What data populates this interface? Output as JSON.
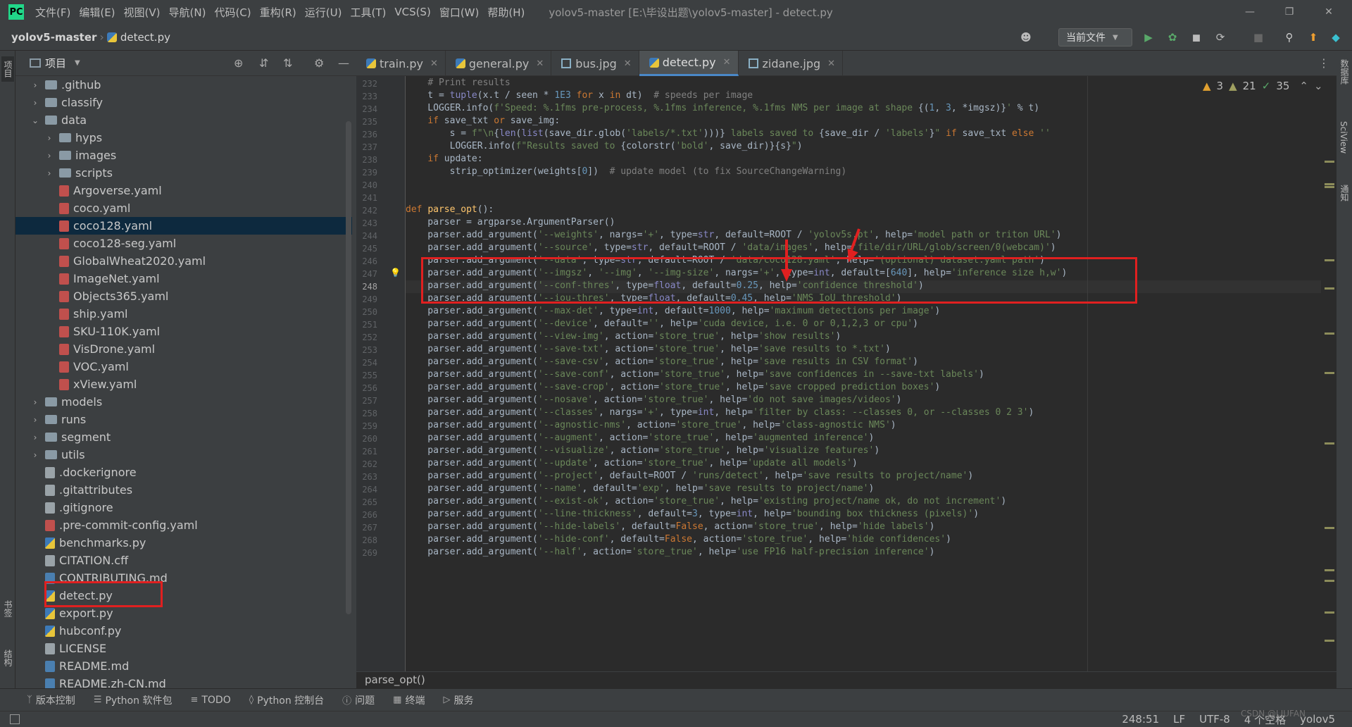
{
  "menubar": {
    "logo": "PC",
    "items": [
      "文件(F)",
      "编辑(E)",
      "视图(V)",
      "导航(N)",
      "代码(C)",
      "重构(R)",
      "运行(U)",
      "工具(T)",
      "VCS(S)",
      "窗口(W)",
      "帮助(H)"
    ],
    "window_title": "yolov5-master [E:\\毕设出题\\yolov5-master] - detect.py"
  },
  "toolbar": {
    "project_name": "yolov5-master",
    "file_name": "detect.py",
    "run_config": "当前文件"
  },
  "left_stripe": {
    "project": "项目",
    "bookmarks": "书签",
    "structure": "结构"
  },
  "project_panel": {
    "title": "项目",
    "tree": [
      {
        "label": ".github",
        "type": "folder",
        "depth": 0,
        "expanded": false
      },
      {
        "label": "classify",
        "type": "folder",
        "depth": 0,
        "expanded": false
      },
      {
        "label": "data",
        "type": "folder",
        "depth": 0,
        "expanded": true
      },
      {
        "label": "hyps",
        "type": "folder",
        "depth": 1,
        "expanded": false
      },
      {
        "label": "images",
        "type": "folder",
        "depth": 1,
        "expanded": false
      },
      {
        "label": "scripts",
        "type": "folder",
        "depth": 1,
        "expanded": false
      },
      {
        "label": "Argoverse.yaml",
        "type": "yaml",
        "depth": 1
      },
      {
        "label": "coco.yaml",
        "type": "yaml",
        "depth": 1
      },
      {
        "label": "coco128.yaml",
        "type": "yaml",
        "depth": 1,
        "selected": true
      },
      {
        "label": "coco128-seg.yaml",
        "type": "yaml",
        "depth": 1
      },
      {
        "label": "GlobalWheat2020.yaml",
        "type": "yaml",
        "depth": 1
      },
      {
        "label": "ImageNet.yaml",
        "type": "yaml",
        "depth": 1
      },
      {
        "label": "Objects365.yaml",
        "type": "yaml",
        "depth": 1
      },
      {
        "label": "ship.yaml",
        "type": "yaml",
        "depth": 1
      },
      {
        "label": "SKU-110K.yaml",
        "type": "yaml",
        "depth": 1
      },
      {
        "label": "VisDrone.yaml",
        "type": "yaml",
        "depth": 1
      },
      {
        "label": "VOC.yaml",
        "type": "yaml",
        "depth": 1
      },
      {
        "label": "xView.yaml",
        "type": "yaml",
        "depth": 1
      },
      {
        "label": "models",
        "type": "folder",
        "depth": 0,
        "expanded": false
      },
      {
        "label": "runs",
        "type": "folder",
        "depth": 0,
        "expanded": false
      },
      {
        "label": "segment",
        "type": "folder",
        "depth": 0,
        "expanded": false
      },
      {
        "label": "utils",
        "type": "folder",
        "depth": 0,
        "expanded": false
      },
      {
        "label": ".dockerignore",
        "type": "txt",
        "depth": 0
      },
      {
        "label": ".gitattributes",
        "type": "txt",
        "depth": 0
      },
      {
        "label": ".gitignore",
        "type": "txt",
        "depth": 0
      },
      {
        "label": ".pre-commit-config.yaml",
        "type": "yaml",
        "depth": 0
      },
      {
        "label": "benchmarks.py",
        "type": "py",
        "depth": 0
      },
      {
        "label": "CITATION.cff",
        "type": "txt",
        "depth": 0
      },
      {
        "label": "CONTRIBUTING.md",
        "type": "md",
        "depth": 0
      },
      {
        "label": "detect.py",
        "type": "py",
        "depth": 0
      },
      {
        "label": "export.py",
        "type": "py",
        "depth": 0
      },
      {
        "label": "hubconf.py",
        "type": "py",
        "depth": 0
      },
      {
        "label": "LICENSE",
        "type": "txt",
        "depth": 0
      },
      {
        "label": "README.md",
        "type": "md",
        "depth": 0
      },
      {
        "label": "README.zh-CN.md",
        "type": "md",
        "depth": 0
      }
    ]
  },
  "tabs": [
    {
      "label": "train.py",
      "icon": "py",
      "active": false
    },
    {
      "label": "general.py",
      "icon": "py",
      "active": false
    },
    {
      "label": "bus.jpg",
      "icon": "image",
      "active": false
    },
    {
      "label": "detect.py",
      "icon": "py",
      "active": true
    },
    {
      "label": "zidane.jpg",
      "icon": "image",
      "active": false
    }
  ],
  "inspections": {
    "warnings": "3",
    "weak_warnings": "21",
    "ok": "35"
  },
  "editor": {
    "current_line": 248,
    "lines": [
      {
        "n": 232,
        "h": "    <span class=\"cmt\"># Print results</span>"
      },
      {
        "n": 233,
        "h": "    t = <span class=\"bi\">tuple</span>(x.t / seen * <span class=\"num\">1E3</span> <span class=\"kw\">for</span> x <span class=\"kw\">in</span> dt)  <span class=\"cmt\"># speeds per image</span>"
      },
      {
        "n": 234,
        "h": "    LOGGER.info(<span class=\"str\">f'Speed: %.1fms pre-process, %.1fms inference, %.1fms NMS per image at shape </span>{(<span class=\"num\">1</span>, <span class=\"num\">3</span>, *imgsz)}<span class=\"str\">'</span> % t)"
      },
      {
        "n": 235,
        "h": "    <span class=\"kw\">if</span> save_txt <span class=\"kw\">or</span> save_img:"
      },
      {
        "n": 236,
        "h": "        s = <span class=\"str\">f\"\\n</span>{<span class=\"bi\">len</span>(<span class=\"bi\">list</span>(save_dir.glob(<span class=\"str\">'labels/*.txt'</span>)))}<span class=\"str\"> labels saved to </span>{save_dir / <span class=\"str\">'labels'</span>}<span class=\"str\">\"</span> <span class=\"kw\">if</span> save_txt <span class=\"kw\">else</span> <span class=\"str\">''</span>"
      },
      {
        "n": 237,
        "h": "        LOGGER.info(<span class=\"str\">f\"Results saved to </span>{colorstr(<span class=\"str\">'bold'</span>, save_dir)}{s}<span class=\"str\">\"</span>)"
      },
      {
        "n": 238,
        "h": "    <span class=\"kw\">if</span> update:"
      },
      {
        "n": 239,
        "h": "        strip_optimizer(weights[<span class=\"num\">0</span>])  <span class=\"cmt\"># update model (to fix SourceChangeWarning)</span>"
      },
      {
        "n": 240,
        "h": ""
      },
      {
        "n": 241,
        "h": ""
      },
      {
        "n": 242,
        "h": "<span class=\"kw\">def</span> <span class=\"fn\">parse_opt</span>():"
      },
      {
        "n": 243,
        "h": "    parser = argparse.ArgumentParser()"
      },
      {
        "n": 244,
        "h": "    parser.add_argument(<span class=\"str\">'--weights'</span>, nargs=<span class=\"str\">'+'</span>, type=<span class=\"bi\">str</span>, default=ROOT / <span class=\"str\">'yolov5s.pt'</span>, help=<span class=\"str\">'model path or triton URL'</span>)"
      },
      {
        "n": 245,
        "h": "    parser.add_argument(<span class=\"str\">'--source'</span>, type=<span class=\"bi\">str</span>, default=ROOT / <span class=\"str\">'data/images'</span>, help=<span class=\"str\">'file/dir/URL/glob/screen/0(webcam)'</span>)"
      },
      {
        "n": 246,
        "h": "    parser.add_argument(<span class=\"str\">'--data'</span>, type=<span class=\"bi\">str</span>, default=ROOT / <span class=\"str\">'data/coco128.yaml'</span>, help=<span class=\"str\">'(optional) dataset.yaml path'</span>)"
      },
      {
        "n": 247,
        "h": "    parser.add_argument(<span class=\"str\">'--imgsz'</span>, <span class=\"str\">'--img'</span>, <span class=\"str\">'--img-size'</span>, nargs=<span class=\"str\">'+'</span>, type=<span class=\"bi\">int</span>, default=[<span class=\"num\">640</span>], help=<span class=\"str\">'inference size h,w'</span>)"
      },
      {
        "n": 248,
        "h": "    parser.add_argument(<span class=\"str\">'--conf-thres'</span>, type=<span class=\"bi\">float</span>, default=<span class=\"num\">0.25</span>, help=<span class=\"str\">'confidence threshold'</span>)"
      },
      {
        "n": 249,
        "h": "    parser.add_argument(<span class=\"str\">'--iou-thres'</span>, type=<span class=\"bi\">float</span>, default=<span class=\"num\">0.45</span>, help=<span class=\"str\">'NMS IoU threshold'</span>)"
      },
      {
        "n": 250,
        "h": "    parser.add_argument(<span class=\"str\">'--max-det'</span>, type=<span class=\"bi\">int</span>, default=<span class=\"num\">1000</span>, help=<span class=\"str\">'maximum detections per image'</span>)"
      },
      {
        "n": 251,
        "h": "    parser.add_argument(<span class=\"str\">'--device'</span>, default=<span class=\"str\">''</span>, help=<span class=\"str\">'cuda device, i.e. 0 or 0,1,2,3 or cpu'</span>)"
      },
      {
        "n": 252,
        "h": "    parser.add_argument(<span class=\"str\">'--view-img'</span>, action=<span class=\"str\">'store_true'</span>, help=<span class=\"str\">'show results'</span>)"
      },
      {
        "n": 253,
        "h": "    parser.add_argument(<span class=\"str\">'--save-txt'</span>, action=<span class=\"str\">'store_true'</span>, help=<span class=\"str\">'save results to *.txt'</span>)"
      },
      {
        "n": 254,
        "h": "    parser.add_argument(<span class=\"str\">'--save-csv'</span>, action=<span class=\"str\">'store_true'</span>, help=<span class=\"str\">'save results in CSV format'</span>)"
      },
      {
        "n": 255,
        "h": "    parser.add_argument(<span class=\"str\">'--save-conf'</span>, action=<span class=\"str\">'store_true'</span>, help=<span class=\"str\">'save confidences in --save-txt labels'</span>)"
      },
      {
        "n": 256,
        "h": "    parser.add_argument(<span class=\"str\">'--save-crop'</span>, action=<span class=\"str\">'store_true'</span>, help=<span class=\"str\">'save cropped prediction boxes'</span>)"
      },
      {
        "n": 257,
        "h": "    parser.add_argument(<span class=\"str\">'--nosave'</span>, action=<span class=\"str\">'store_true'</span>, help=<span class=\"str\">'do not save images/videos'</span>)"
      },
      {
        "n": 258,
        "h": "    parser.add_argument(<span class=\"str\">'--classes'</span>, nargs=<span class=\"str\">'+'</span>, type=<span class=\"bi\">int</span>, help=<span class=\"str\">'filter by class: --classes 0, or --classes 0 2 3'</span>)"
      },
      {
        "n": 259,
        "h": "    parser.add_argument(<span class=\"str\">'--agnostic-nms'</span>, action=<span class=\"str\">'store_true'</span>, help=<span class=\"str\">'class-agnostic NMS'</span>)"
      },
      {
        "n": 260,
        "h": "    parser.add_argument(<span class=\"str\">'--augment'</span>, action=<span class=\"str\">'store_true'</span>, help=<span class=\"str\">'augmented inference'</span>)"
      },
      {
        "n": 261,
        "h": "    parser.add_argument(<span class=\"str\">'--visualize'</span>, action=<span class=\"str\">'store_true'</span>, help=<span class=\"str\">'visualize features'</span>)"
      },
      {
        "n": 262,
        "h": "    parser.add_argument(<span class=\"str\">'--update'</span>, action=<span class=\"str\">'store_true'</span>, help=<span class=\"str\">'update all models'</span>)"
      },
      {
        "n": 263,
        "h": "    parser.add_argument(<span class=\"str\">'--project'</span>, default=ROOT / <span class=\"str\">'runs/detect'</span>, help=<span class=\"str\">'save results to project/name'</span>)"
      },
      {
        "n": 264,
        "h": "    parser.add_argument(<span class=\"str\">'--name'</span>, default=<span class=\"str\">'exp'</span>, help=<span class=\"str\">'save results to project/name'</span>)"
      },
      {
        "n": 265,
        "h": "    parser.add_argument(<span class=\"str\">'--exist-ok'</span>, action=<span class=\"str\">'store_true'</span>, help=<span class=\"str\">'existing project/name ok, do not increment'</span>)"
      },
      {
        "n": 266,
        "h": "    parser.add_argument(<span class=\"str\">'--line-thickness'</span>, default=<span class=\"num\">3</span>, type=<span class=\"bi\">int</span>, help=<span class=\"str\">'bounding box thickness (pixels)'</span>)"
      },
      {
        "n": 267,
        "h": "    parser.add_argument(<span class=\"str\">'--hide-labels'</span>, default=<span class=\"kw\">False</span>, action=<span class=\"str\">'store_true'</span>, help=<span class=\"str\">'hide labels'</span>)"
      },
      {
        "n": 268,
        "h": "    parser.add_argument(<span class=\"str\">'--hide-conf'</span>, default=<span class=\"kw\">False</span>, action=<span class=\"str\">'store_true'</span>, help=<span class=\"str\">'hide confidences'</span>)"
      },
      {
        "n": 269,
        "h": "    parser.add_argument(<span class=\"str\">'--half'</span>, action=<span class=\"str\">'store_true'</span>, help=<span class=\"str\">'use FP16 half-precision inference'</span>)"
      }
    ]
  },
  "editor_breadcrumb": "parse_opt()",
  "right_stripe": {
    "database": "数据库",
    "sciview": "SciView",
    "notifications": "通知"
  },
  "bottom_tools": [
    "版本控制",
    "Python 软件包",
    "TODO",
    "Python 控制台",
    "问题",
    "终端",
    "服务"
  ],
  "statusbar": {
    "position": "248:51",
    "line_sep": "LF",
    "encoding": "UTF-8",
    "indent": "4 个空格",
    "interpreter": "yolov5"
  },
  "watermark": "CSDN @LIUFAN",
  "colors": {
    "highlight": "#e02020",
    "accent": "#4a88c7"
  }
}
